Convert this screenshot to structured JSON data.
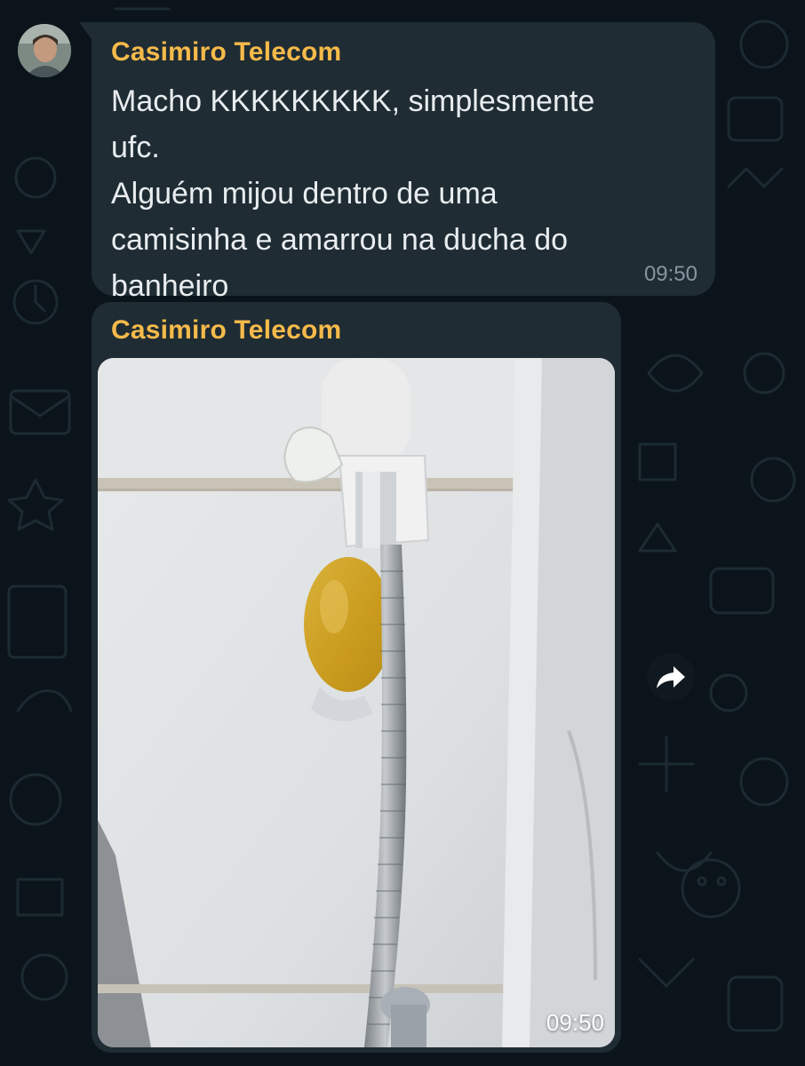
{
  "chat": {
    "messages": [
      {
        "sender": "Casimiro Telecom",
        "text": "Macho KKKKKKKKK, simplesmente\nufc.\nAlguém mijou dentro de uma\ncamisinha  e amarrou na ducha do\nbanheiro",
        "time": "09:50",
        "sender_color": "#f6ba4a"
      },
      {
        "sender": "Casimiro Telecom",
        "type": "image",
        "time": "09:50",
        "sender_color": "#f6ba4a"
      }
    ],
    "forward_icon": "forward-arrow-icon",
    "colors": {
      "background": "#0b141a",
      "bubble": "#1f2c34",
      "text": "#e9edef",
      "meta": "#8696a0"
    }
  }
}
